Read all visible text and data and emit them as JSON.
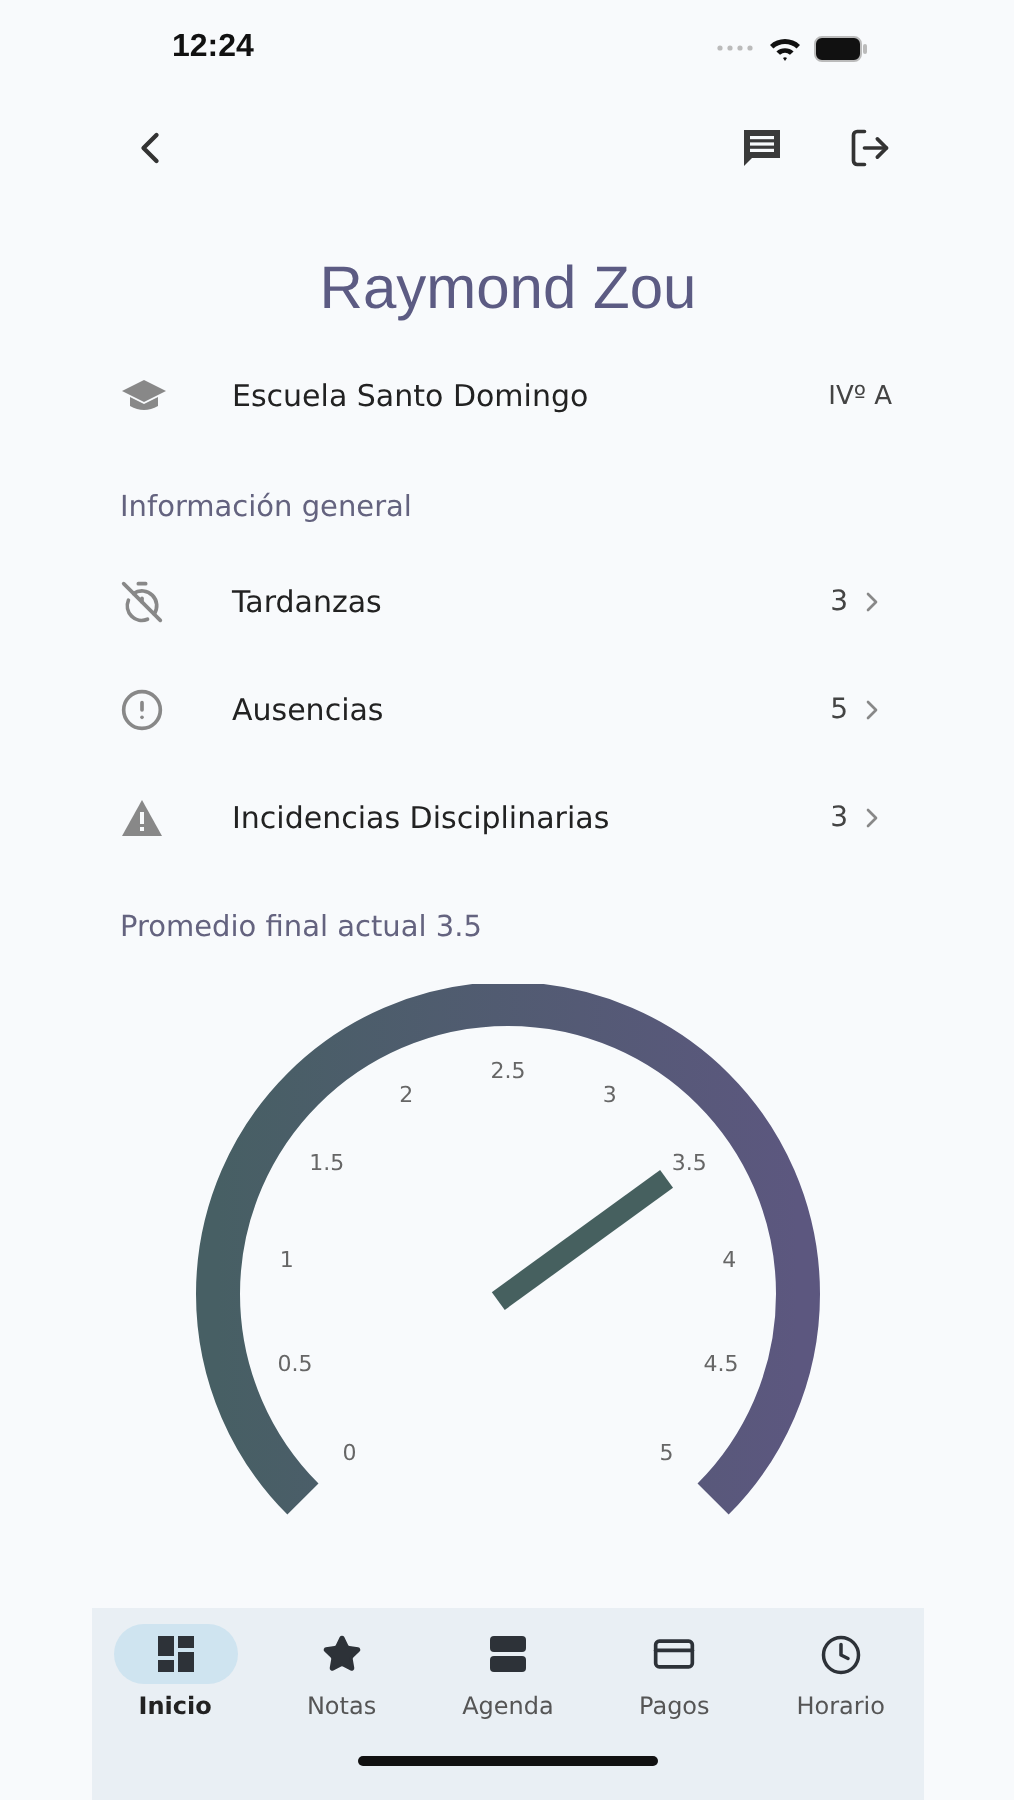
{
  "status_bar": {
    "time": "12:24"
  },
  "student": {
    "name": "Raymond Zou"
  },
  "school": {
    "name": "Escuela Santo Domingo",
    "class": "IVº A"
  },
  "general": {
    "title": "Información general",
    "items": [
      {
        "kind": "late",
        "label": "Tardanzas",
        "count": "3"
      },
      {
        "kind": "absence",
        "label": "Ausencias",
        "count": "5"
      },
      {
        "kind": "discipline",
        "label": "Incidencias Disciplinarias",
        "count": "3"
      }
    ]
  },
  "average": {
    "title": "Promedio final actual 3.5",
    "gauge": {
      "level": 0.7,
      "ticks": [
        "0",
        "0.5",
        "1",
        "1.5",
        "2",
        "2.5",
        "3",
        "3.5",
        "4",
        "4.5",
        "5"
      ]
    }
  },
  "nav": [
    {
      "kind": "home",
      "label": "Inicio",
      "selected": true
    },
    {
      "kind": "grades",
      "label": "Notas",
      "selected": false
    },
    {
      "kind": "agenda",
      "label": "Agenda",
      "selected": false
    },
    {
      "kind": "payments",
      "label": "Pagos",
      "selected": false
    },
    {
      "kind": "schedule",
      "label": "Horario",
      "selected": false
    }
  ]
}
